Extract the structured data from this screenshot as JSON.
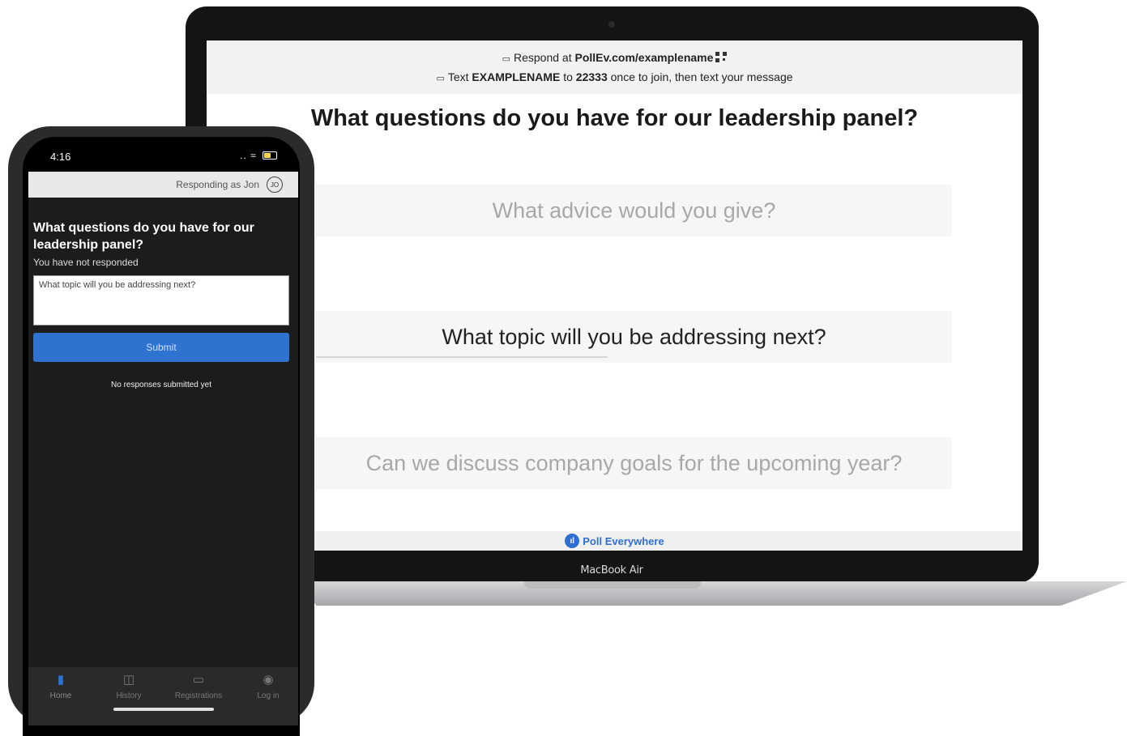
{
  "laptop": {
    "respond_prefix": "Respond at",
    "respond_url": "PollEv.com/examplename",
    "text_prefix": "Text",
    "text_keyword": "EXAMPLENAME",
    "text_to": "to",
    "text_number": "22333",
    "text_suffix": "once to join, then text your message",
    "question": "What questions do you have for our leadership panel?",
    "answers": [
      "What advice would you give?",
      "What topic will you be addressing next?",
      "Can we discuss company goals for the upcoming year?"
    ],
    "brand": "Poll Everywhere",
    "model": "MacBook Air"
  },
  "phone": {
    "time": "4:16",
    "responding_as": "Responding as Jon",
    "avatar_initials": "JO",
    "question": "What questions do you have for our leadership panel?",
    "status": "You have not responded",
    "input_value": "What topic will you be addressing next?",
    "submit_label": "Submit",
    "no_responses": "No responses submitted yet",
    "tabs": [
      {
        "label": "Home",
        "icon": "bar-chart-icon"
      },
      {
        "label": "History",
        "icon": "history-icon"
      },
      {
        "label": "Registrations",
        "icon": "registrations-icon"
      },
      {
        "label": "Log in",
        "icon": "user-icon"
      }
    ]
  },
  "colors": {
    "accent": "#2f73d1",
    "brand": "#2f6fcf"
  }
}
